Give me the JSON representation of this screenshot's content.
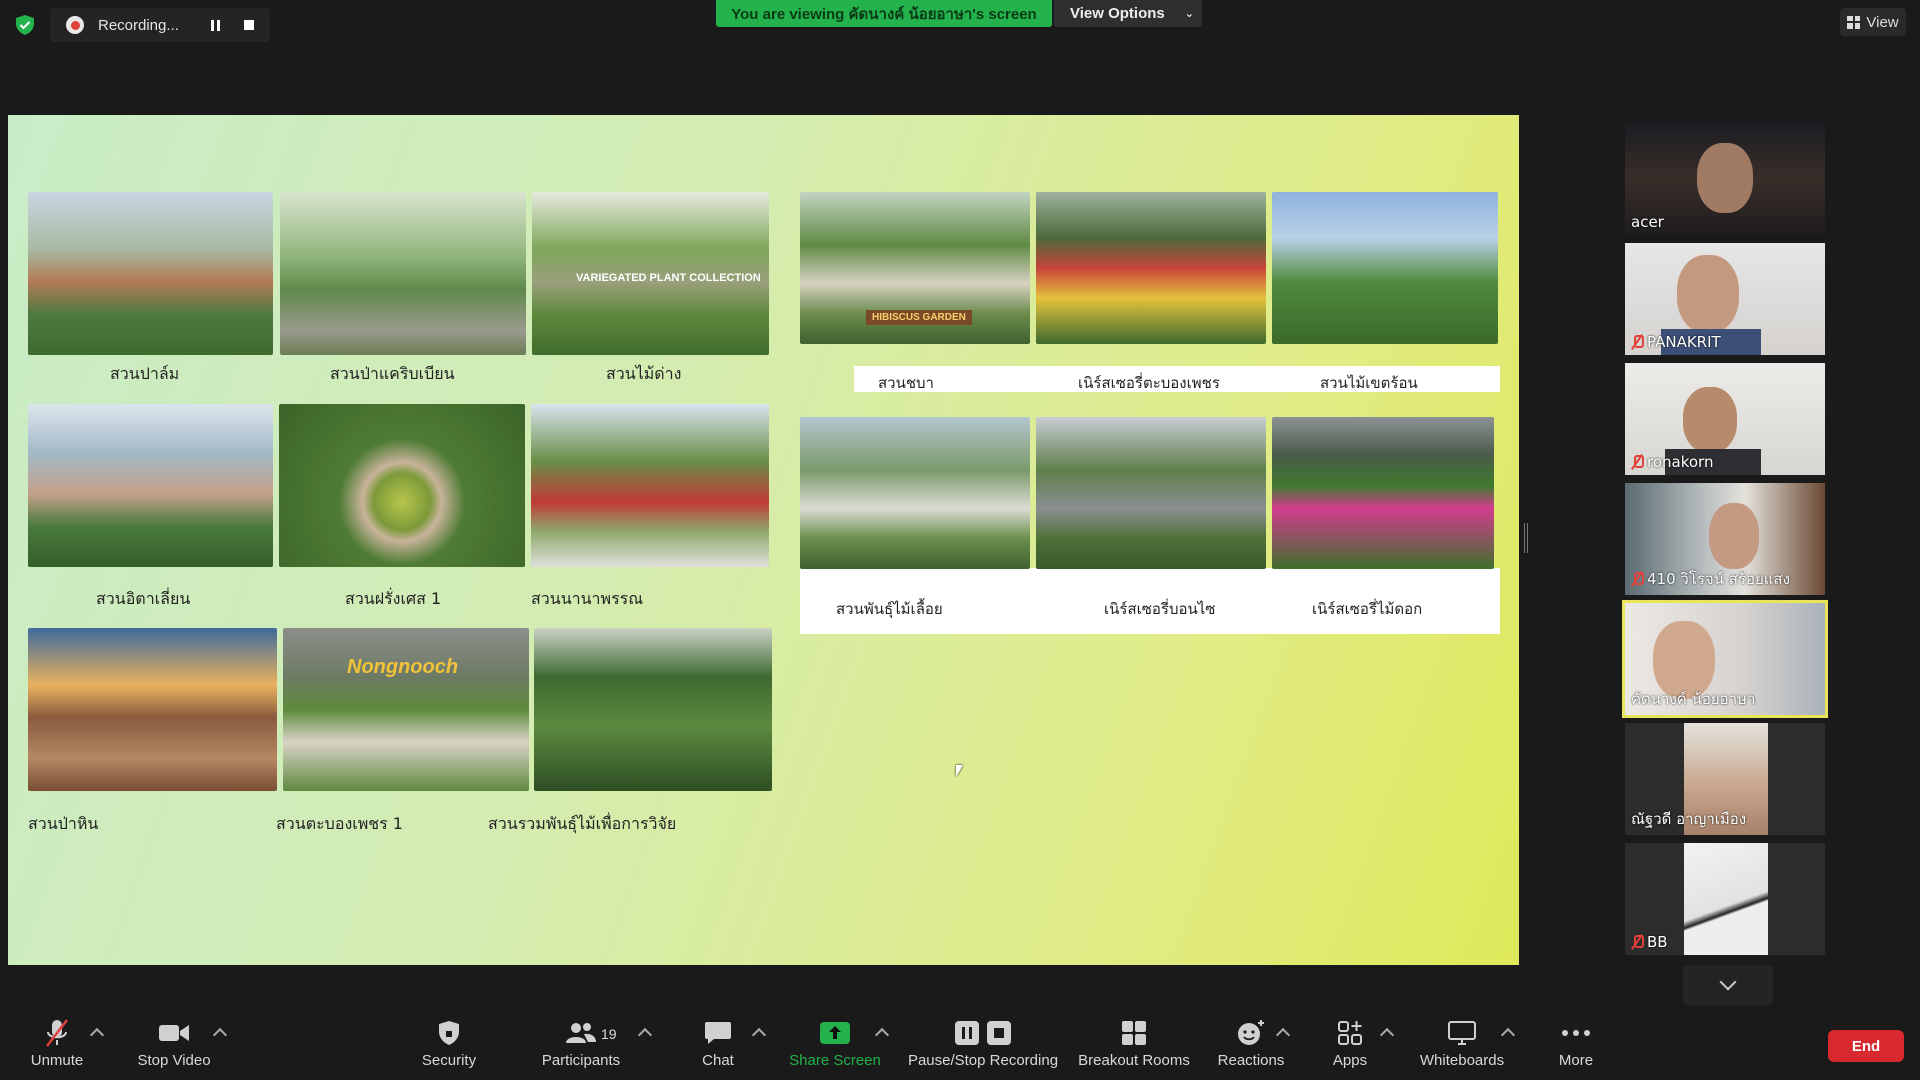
{
  "topbar": {
    "recording_label": "Recording...",
    "viewing_banner": "You are viewing คัดนางค์ น้อยอาษา's screen",
    "view_options_label": "View Options",
    "view_label": "View"
  },
  "slide": {
    "left_captions": [
      "สวนปาล์ม",
      "สวนป่าแคริบเบียน",
      "สวนไม้ด่าง",
      "สวนอิตาเลี่ยน",
      "สวนฝรั่งเศส 1",
      "สวนนานาพรรณ",
      "สวนป่าหิน",
      "สวนตะบองเพชร 1",
      "สวนรวมพันธุ์ไม้เพื่อการวิจัย"
    ],
    "right_captions": [
      "สวนชบา",
      "เนิร์สเซอรี่ตะบองเพชร",
      "สวนไม้เขตร้อน",
      "สวนพันธุ์ไม้เลื้อย",
      "เนิร์สเซอรี่บอนไซ",
      "เนิร์สเซอรี่ไม้ดอก"
    ],
    "photo_signs": [
      "VARIEGATED PLANT COLLECTION",
      "HIBISCUS GARDEN",
      "Nongnooch"
    ]
  },
  "participants": [
    {
      "name": "acer",
      "muted": false
    },
    {
      "name": "PANAKRIT",
      "muted": true
    },
    {
      "name": "ronakorn",
      "muted": true
    },
    {
      "name": "410 วิโรจน์ สร้อยแสง",
      "muted": true
    },
    {
      "name": "คัดนางค์ น้อยอาษา",
      "muted": false
    },
    {
      "name": "ณัฐวดี อาญาเมือง",
      "muted": false
    },
    {
      "name": "BB",
      "muted": true
    }
  ],
  "toolbar": {
    "unmute": "Unmute",
    "stop_video": "Stop Video",
    "security": "Security",
    "participants": "Participants",
    "participants_count": "19",
    "chat": "Chat",
    "share_screen": "Share Screen",
    "pause_stop_recording": "Pause/Stop Recording",
    "breakout_rooms": "Breakout Rooms",
    "reactions": "Reactions",
    "apps": "Apps",
    "whiteboards": "Whiteboards",
    "more": "More",
    "end": "End"
  },
  "colors": {
    "banner_green": "#23b24b",
    "end_red": "#d8292f",
    "active_speaker": "#e8e55a",
    "share_screen_green": "#23b24b"
  }
}
